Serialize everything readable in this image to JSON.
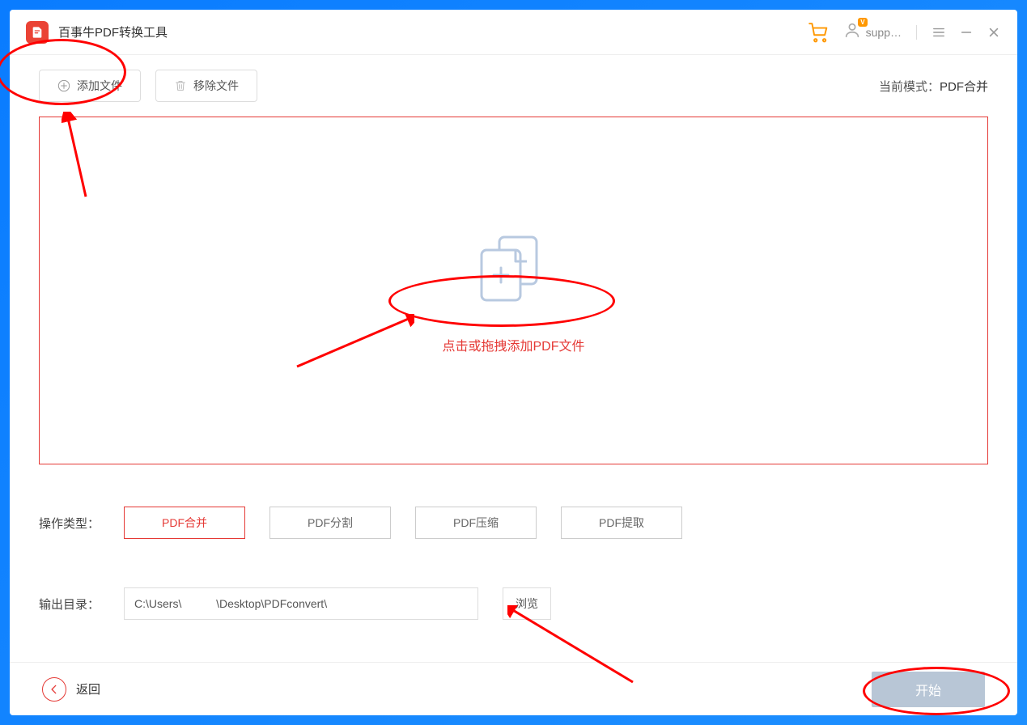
{
  "app": {
    "title": "百事牛PDF转换工具",
    "user_label": "supp…"
  },
  "toolbar": {
    "add_file": "添加文件",
    "remove_file": "移除文件",
    "mode_prefix": "当前模式：",
    "mode_value": "PDF合并"
  },
  "drop_zone": {
    "text": "点击或拖拽添加PDF文件"
  },
  "operation": {
    "label": "操作类型：",
    "options": [
      "PDF合并",
      "PDF分割",
      "PDF压缩",
      "PDF提取"
    ],
    "active_index": 0
  },
  "output": {
    "label": "输出目录：",
    "path": "C:\\Users\\           \\Desktop\\PDFconvert\\",
    "browse": "浏览"
  },
  "footer": {
    "back": "返回",
    "start": "开始"
  }
}
